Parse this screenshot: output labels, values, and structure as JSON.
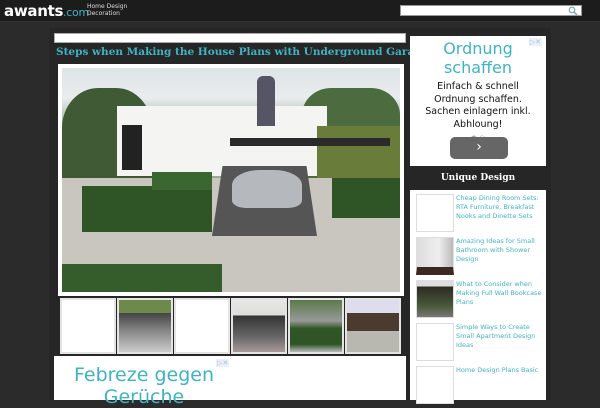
{
  "header": {
    "logo": "awants",
    "logo_tld": ".com",
    "tagline_1": "Home Design",
    "tagline_2": "Decoration",
    "search_placeholder": ""
  },
  "article": {
    "title": "Steps when Making the House Plans with Underground Garage"
  },
  "thumbnails": [
    {
      "type": "blank"
    },
    {
      "type": "photo"
    },
    {
      "type": "blank"
    },
    {
      "type": "photo"
    },
    {
      "type": "photo"
    },
    {
      "type": "photo"
    }
  ],
  "ad_bottom": {
    "headline_1": "Febreze gegen",
    "headline_2": "Gerüche",
    "marker": "▷✕"
  },
  "ad_right": {
    "headline_1": "Ordnung",
    "headline_2": "schaffen",
    "body": [
      "Einfach & schnell",
      "Ordnung schaffen.",
      "Sachen einlagern inkl.",
      "Abhloung!"
    ],
    "dots": "● ○",
    "next": "›",
    "marker": "▷✕"
  },
  "sidebar": {
    "heading": "Unique Design",
    "items": [
      {
        "label": "Cheap Dining Room Sets: RTA Furniture, Breakfast Nooks and Dinette Sets"
      },
      {
        "label": "Amazing Ideas for Small Bathroom with Shower Design"
      },
      {
        "label": "What to Consider when Making Full Wall Bookcase Plans"
      },
      {
        "label": "Simple Ways to Create Small Apartment Design Ideas"
      },
      {
        "label": "Home Design Plans Basic"
      }
    ]
  },
  "colors": {
    "accent": "#3fb3c4",
    "topbar": "#1c1c1c",
    "background": "#2b2b2b"
  }
}
